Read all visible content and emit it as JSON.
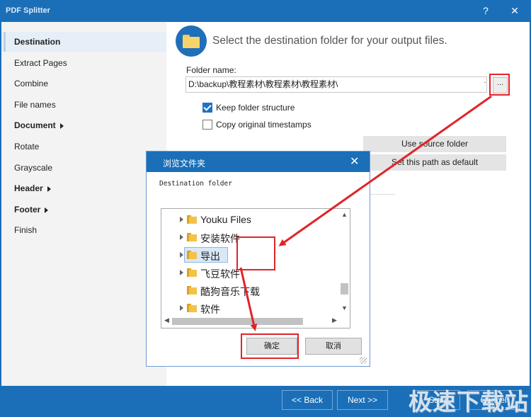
{
  "window": {
    "title": "PDF Splitter",
    "help_glyph": "?",
    "close_glyph": "✕"
  },
  "sidebar": {
    "items": [
      {
        "label": "Destination"
      },
      {
        "label": "Extract Pages"
      },
      {
        "label": "Combine"
      },
      {
        "label": "File names"
      },
      {
        "label": "Document"
      },
      {
        "label": "Rotate"
      },
      {
        "label": "Grayscale"
      },
      {
        "label": "Header"
      },
      {
        "label": "Footer"
      },
      {
        "label": "Finish"
      }
    ]
  },
  "main": {
    "heading": "Select the destination folder for your output files.",
    "folder_label": "Folder name:",
    "folder_value": "D:\\backup\\教程素材\\教程素材\\教程素材\\",
    "dot_label": ".",
    "browse_label": "...",
    "keep_structure": {
      "label": "Keep folder structure",
      "checked": true
    },
    "copy_timestamps": {
      "label": "Copy original timestamps",
      "checked": false
    },
    "use_source_label": "Use source folder",
    "set_default_label": "Set this path as default"
  },
  "footer": {
    "back_label": "<< Back",
    "next_label": "Next >>",
    "start_label": "Start",
    "cancel_label": "Cancel"
  },
  "watermark": "极速下载站",
  "dialog": {
    "title": "浏览文件夹",
    "close_glyph": "✕",
    "label": "Destination folder",
    "items": [
      {
        "name": "Youku Files",
        "has_children": true,
        "selected": false
      },
      {
        "name": "安装软件",
        "has_children": true,
        "selected": false
      },
      {
        "name": "导出",
        "has_children": true,
        "selected": true
      },
      {
        "name": "飞豆软件",
        "has_children": true,
        "selected": false
      },
      {
        "name": "酷狗音乐下载",
        "has_children": false,
        "selected": false
      },
      {
        "name": "软件",
        "has_children": true,
        "selected": false
      }
    ],
    "ok_label": "确定",
    "cancel_label": "取消"
  },
  "colors": {
    "titlebar": "#1a6fb8",
    "sidebar_bg": "#f3f3f3",
    "annotation_red": "#e0242a",
    "checkbox_checked": "#1e73c8"
  }
}
